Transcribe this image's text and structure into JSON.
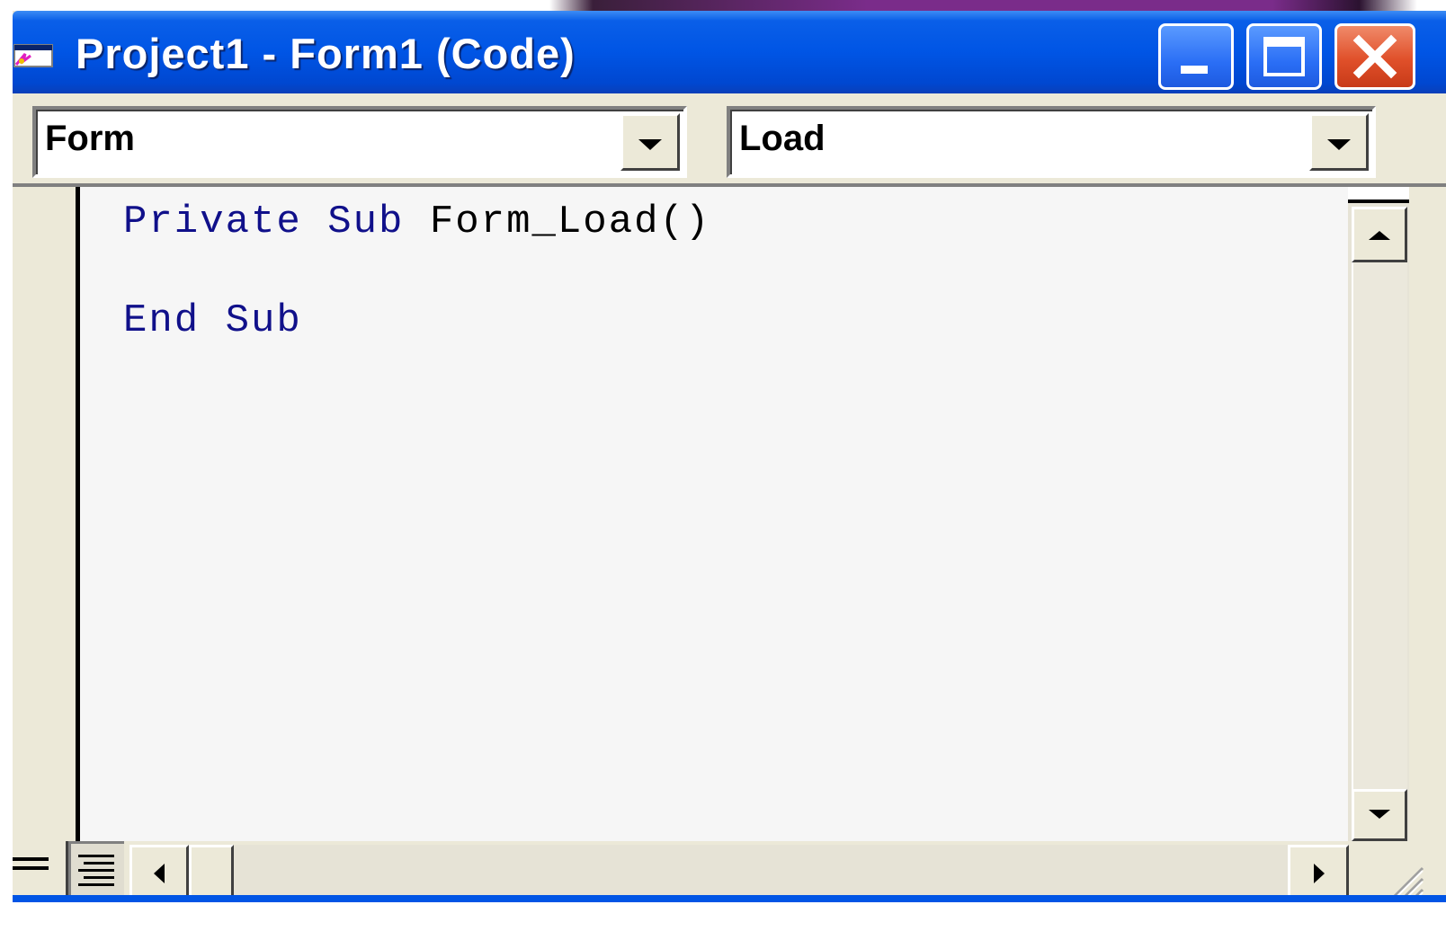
{
  "window": {
    "title": "Project1 - Form1 (Code)",
    "title_color": "#0055E5",
    "controls": [
      "minimize",
      "maximize",
      "close"
    ]
  },
  "object_combo": {
    "value": "Form"
  },
  "procedure_combo": {
    "value": "Load"
  },
  "code": {
    "lines": [
      {
        "keyword": "Private Sub",
        "rest": " Form_Load()"
      },
      {
        "keyword": "End Sub",
        "rest": ""
      }
    ],
    "keyword_color": "#10108A"
  },
  "icons": {
    "window": "vb-form-icon",
    "minimize": "minimize-icon",
    "maximize": "maximize-icon",
    "close": "close-icon",
    "dropdown": "chevron-down-icon",
    "procedure_view": "procedure-view-icon",
    "full_module_view": "full-module-view-icon"
  }
}
